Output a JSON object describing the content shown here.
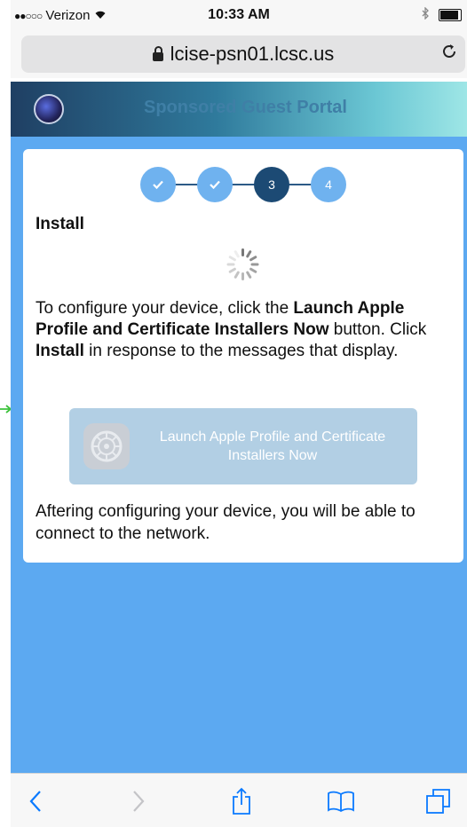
{
  "status_bar": {
    "signal": "●●○○○",
    "carrier": "Verizon",
    "time": "10:33 AM"
  },
  "browser": {
    "url": "lcise-psn01.lcsc.us"
  },
  "portal": {
    "title": "Sponsored Guest Portal"
  },
  "steps": [
    {
      "label": "✓",
      "state": "done"
    },
    {
      "label": "✓",
      "state": "done"
    },
    {
      "label": "3",
      "state": "active"
    },
    {
      "label": "4",
      "state": "pending"
    }
  ],
  "install": {
    "heading": "Install",
    "desc_part1": "To configure your device, click the ",
    "desc_bold1": "Launch Apple Profile and Certificate Installers Now",
    "desc_part2": " button. Click ",
    "desc_bold2": "Install",
    "desc_part3": " in response to the messages that display.",
    "launch_button_label": "Launch Apple Profile and Certificate Installers Now",
    "footer": "Aftering configuring your device, you will be able to connect to the network."
  },
  "toolbar": {
    "items": [
      "back-icon",
      "forward-icon",
      "share-icon",
      "bookmarks-icon",
      "tabs-icon"
    ]
  },
  "colors": {
    "page_background": "#5ca9f1",
    "step_done": "#6fb2ef",
    "step_active": "#1c4a74",
    "button_disabled": "#b2cfe4",
    "safari_blue": "#0a7aff"
  }
}
